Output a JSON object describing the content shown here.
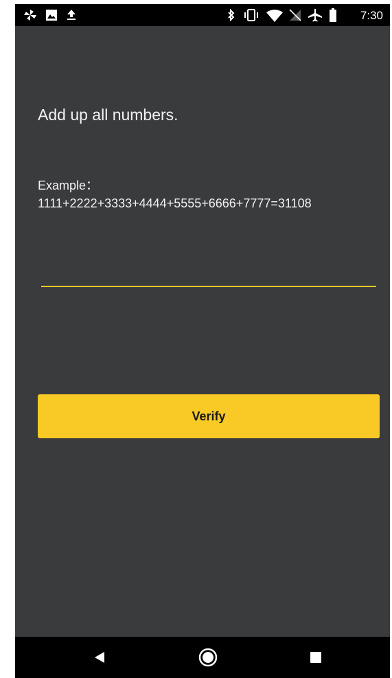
{
  "status_bar": {
    "time": "7:30",
    "left_icons": [
      "pinwheel-icon",
      "image-icon",
      "upload-icon"
    ],
    "right_icons": [
      "bluetooth-icon",
      "vibrate-icon",
      "wifi-icon",
      "no-sim-icon",
      "airplane-mode-icon",
      "battery-icon"
    ]
  },
  "main": {
    "title": "Add up all numbers.",
    "example_label": "Example：",
    "example_text": "1111+2222+3333+4444+5555+6666+7777=31108",
    "input": {
      "value": "",
      "placeholder": ""
    },
    "verify_label": "Verify"
  },
  "nav_bar": {
    "icons": [
      "back-icon",
      "home-icon",
      "recents-icon"
    ]
  },
  "colors": {
    "background": "#3a3b3d",
    "accent": "#f9c926",
    "bars": "#000000",
    "text": "#f2f2f2"
  }
}
